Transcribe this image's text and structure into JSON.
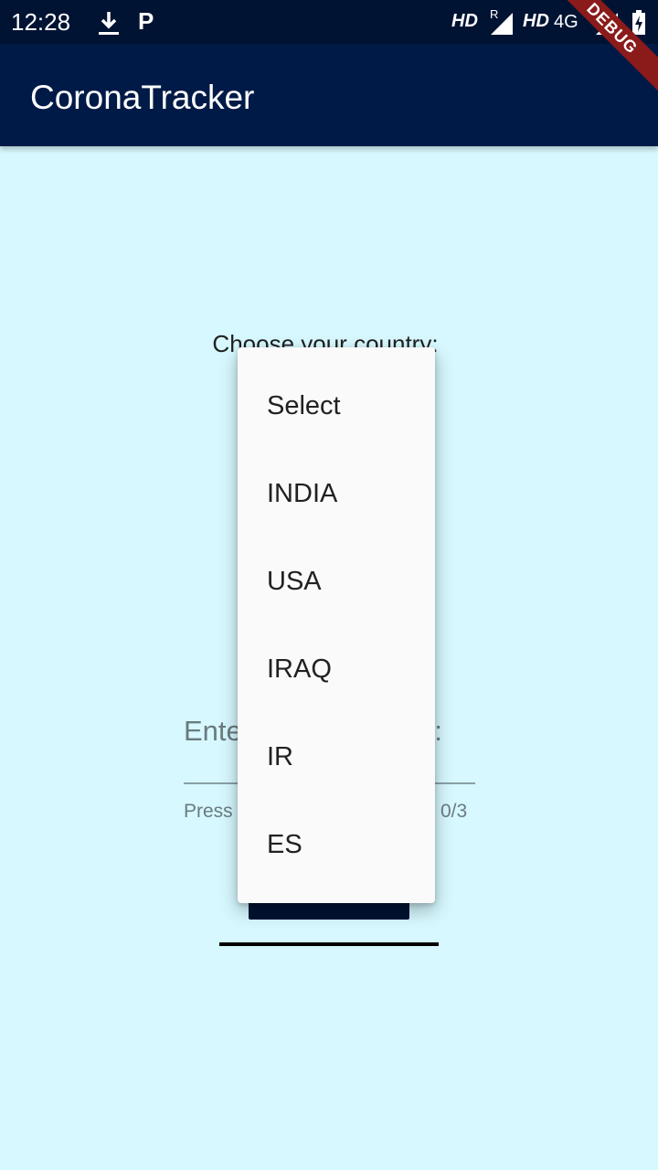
{
  "status_bar": {
    "time": "12:28",
    "download_icon": "download-icon",
    "parking_icon": "P",
    "hd1": "HD",
    "roaming": "R",
    "hd2": "HD",
    "network": "4G",
    "battery_icon": "battery-charging-icon"
  },
  "app_bar": {
    "title": "CoronaTracker",
    "background": "#001a47"
  },
  "debug_banner": "DEBUG",
  "country_selector": {
    "label": "Choose your country:"
  },
  "dropdown": {
    "items": [
      "Select",
      "INDIA",
      "USA",
      "IRAQ",
      "IR",
      "ES"
    ]
  },
  "input_field": {
    "label_start": "Ente",
    "label_end": ":",
    "helper_start": "Press",
    "counter": "0/3"
  },
  "colors": {
    "background": "#d6f8fe",
    "primary_dark": "#001333",
    "menu_background": "#fafafa"
  }
}
